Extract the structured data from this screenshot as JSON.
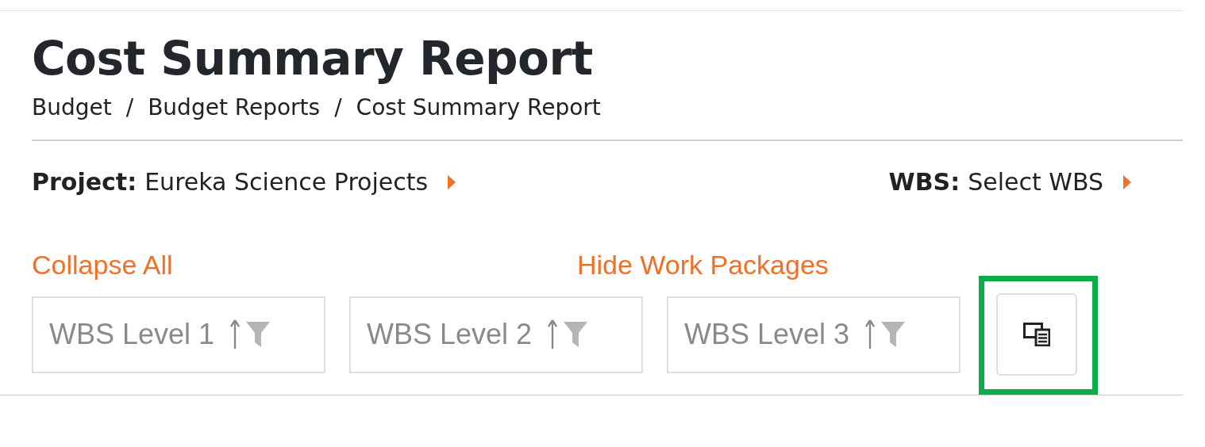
{
  "page": {
    "title": "Cost Summary Report"
  },
  "breadcrumb": [
    {
      "label": "Budget"
    },
    {
      "label": "Budget Reports"
    },
    {
      "label": "Cost Summary Report"
    }
  ],
  "breadcrumb_separator": "/",
  "selectors": [
    {
      "label": "Project:",
      "value": "Eureka Science Projects"
    },
    {
      "label": "WBS:",
      "value": "Select WBS"
    }
  ],
  "actions": [
    {
      "label": "Collapse All"
    },
    {
      "label": "Hide Work Packages"
    }
  ],
  "columns": [
    {
      "label": "WBS Level 1"
    },
    {
      "label": "WBS Level 2"
    },
    {
      "label": "WBS Level 3"
    }
  ],
  "column_chooser": {
    "highlighted": true
  }
}
